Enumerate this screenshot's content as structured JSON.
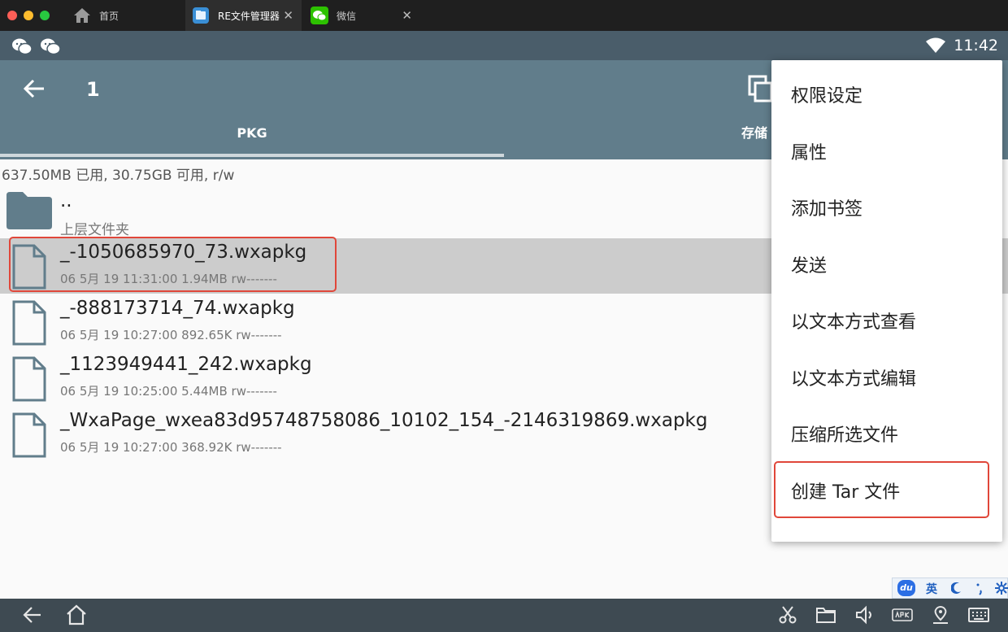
{
  "browser": {
    "tabs": [
      {
        "label": "首页"
      },
      {
        "label": "RE文件管理器"
      },
      {
        "label": "微信"
      }
    ],
    "close_glyph": "✕"
  },
  "status_bar": {
    "time": "11:42",
    "icons": [
      "wechat-icon",
      "wechat-icon",
      "wifi-icon"
    ]
  },
  "toolbar": {
    "title": "1",
    "tabs": [
      {
        "label": "PKG",
        "active": true
      },
      {
        "label": "存储"
      }
    ]
  },
  "storage_info": "637.50MB 已用, 30.75GB 可用, r/w",
  "files": [
    {
      "name": "..",
      "meta": "上层文件夹",
      "type": "folder"
    },
    {
      "name": "_-1050685970_73.wxapkg",
      "meta": "06 5月 19 11:31:00  1.94MB  rw-------",
      "type": "file",
      "selected": true
    },
    {
      "name": "_-888173714_74.wxapkg",
      "meta": "06 5月 19 10:27:00  892.65K  rw-------",
      "type": "file"
    },
    {
      "name": "_1123949441_242.wxapkg",
      "meta": "06 5月 19 10:25:00  5.44MB  rw-------",
      "type": "file"
    },
    {
      "name": "_WxaPage_wxea83d95748758086_10102_154_-2146319869.wxapkg",
      "meta": "06 5月 19 10:27:00  368.92K  rw-------",
      "type": "file"
    }
  ],
  "menu": {
    "items": [
      "权限设定",
      "属性",
      "添加书签",
      "发送",
      "以文本方式查看",
      "以文本方式编辑",
      "压缩所选文件",
      "创建 Tar 文件"
    ],
    "highlighted_item": "创建 Tar 文件"
  },
  "ime": {
    "logo": "du",
    "lang": "英"
  },
  "colors": {
    "app_bar": "#617d8b",
    "status_bar": "#4a5d6a",
    "highlight": "#e0473a",
    "nav_bar": "#3e4a52"
  }
}
